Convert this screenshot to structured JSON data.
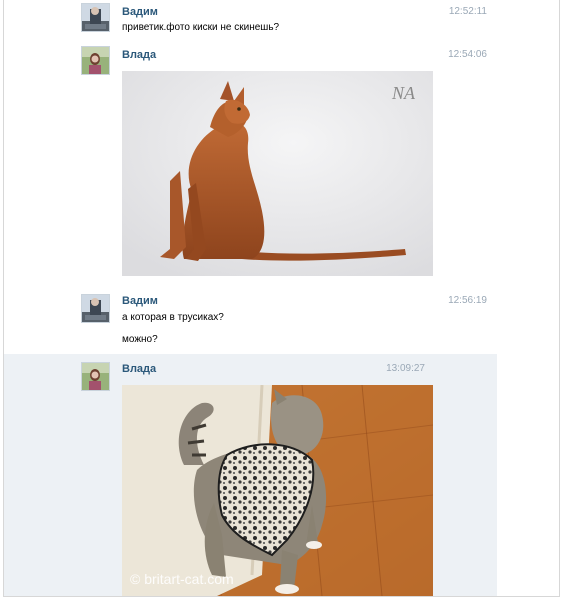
{
  "messages": [
    {
      "author": "Вадим",
      "time": "12:52:11",
      "lines": [
        "приветик.фото киски не скинешь?"
      ]
    },
    {
      "author": "Влада",
      "time": "12:54:06",
      "photo": {
        "kind": "cat-abyssinian",
        "signature": "NA"
      }
    },
    {
      "author": "Вадим",
      "time": "12:56:19",
      "lines": [
        "а которая в трусиках?",
        "можно?"
      ]
    },
    {
      "author": "Влада",
      "time": "13:09:27",
      "photo": {
        "kind": "cat-in-panties",
        "watermark": "© britart-cat.com"
      }
    }
  ]
}
